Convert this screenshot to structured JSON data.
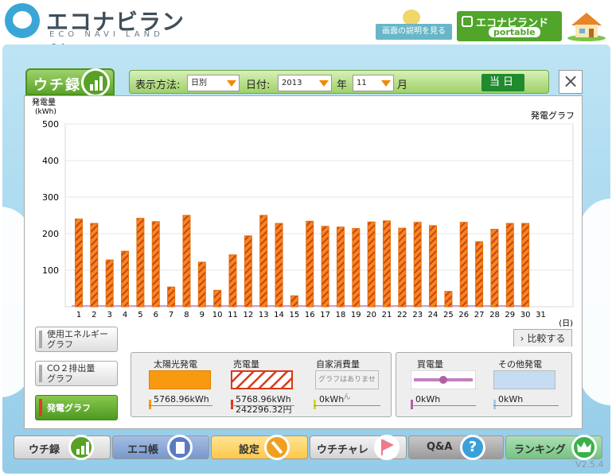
{
  "header": {
    "logo_main": "エコナビランド",
    "logo_sub": "ECO NAVI LAND",
    "help_label": "画面の説明を見る",
    "portable_title": "エコナビランド",
    "portable_sub": "portable"
  },
  "tab": {
    "label": "ウチ録"
  },
  "controls": {
    "display_label": "表示方法:",
    "display_value": "日別",
    "date_label": "日付:",
    "year_value": "2013",
    "year_unit": "年",
    "month_value": "11",
    "month_unit": "月",
    "today_label": "当日",
    "close_label": "×"
  },
  "chart_data": {
    "type": "bar",
    "title": "発電グラフ",
    "ylabel_line1": "発電量",
    "ylabel_line2": "(kWh)",
    "xlabel": "(日)",
    "ylim": [
      0,
      500
    ],
    "yticks": [
      100,
      200,
      300,
      400,
      500
    ],
    "categories": [
      "1",
      "2",
      "3",
      "4",
      "5",
      "6",
      "7",
      "8",
      "9",
      "10",
      "11",
      "12",
      "13",
      "14",
      "15",
      "16",
      "17",
      "18",
      "19",
      "20",
      "21",
      "22",
      "23",
      "24",
      "25",
      "26",
      "27",
      "28",
      "29",
      "30",
      "31"
    ],
    "values": [
      240,
      228,
      128,
      152,
      242,
      233,
      54,
      250,
      122,
      45,
      142,
      194,
      250,
      228,
      30,
      234,
      220,
      218,
      214,
      232,
      235,
      215,
      231,
      222,
      42,
      231,
      178,
      212,
      228,
      228,
      0
    ],
    "bar_color": "#f08a1c",
    "hatch_color": "#d83a1a"
  },
  "side_buttons": [
    {
      "label1": "使用エネルギー",
      "label2": "グラフ"
    },
    {
      "label1": "CO２排出量",
      "label2": "グラフ"
    },
    {
      "label1": "発電グラフ",
      "label2": ""
    }
  ],
  "compare_label": "比較する",
  "legend": {
    "solar": {
      "title": "太陽光発電",
      "value": "5768.96kWh",
      "color": "#f89a10"
    },
    "sold": {
      "title": "売電量",
      "value": "5768.96kWh",
      "value2": "242296.32円",
      "color": "#d83a1a"
    },
    "self": {
      "title": "自家消費量",
      "swatch_text": "グラフはありません",
      "value": "0kWh",
      "color": "#d6d62a"
    },
    "bought": {
      "title": "買電量",
      "value": "0kWh",
      "color": "#b060a8"
    },
    "other": {
      "title": "その他発電",
      "value": "0kWh",
      "color": "#a8c8e8"
    }
  },
  "nav": [
    {
      "label": "ウチ録",
      "color": "#e2e2e2",
      "icon": "bar-chart-icon",
      "icon_color": "#57a126"
    },
    {
      "label": "エコ帳",
      "color": "#8aa8d8",
      "icon": "notebook-icon",
      "icon_color": "#5a7cc0"
    },
    {
      "label": "設定",
      "color": "#ffd56a",
      "icon": "wrench-icon",
      "icon_color": "#f0a020"
    },
    {
      "label": "ウチチャレ",
      "color": "#e2e2e2",
      "icon": "flag-icon",
      "icon_color": "#f07a8a"
    },
    {
      "label": "Q&A",
      "color": "#a8a8a8",
      "icon": "question-icon",
      "icon_color": "#3aa0d8"
    },
    {
      "label": "ランキング",
      "color": "#8fd49a",
      "icon": "crown-icon",
      "icon_color": "#3ab04a"
    }
  ],
  "version": "V2.5.4"
}
